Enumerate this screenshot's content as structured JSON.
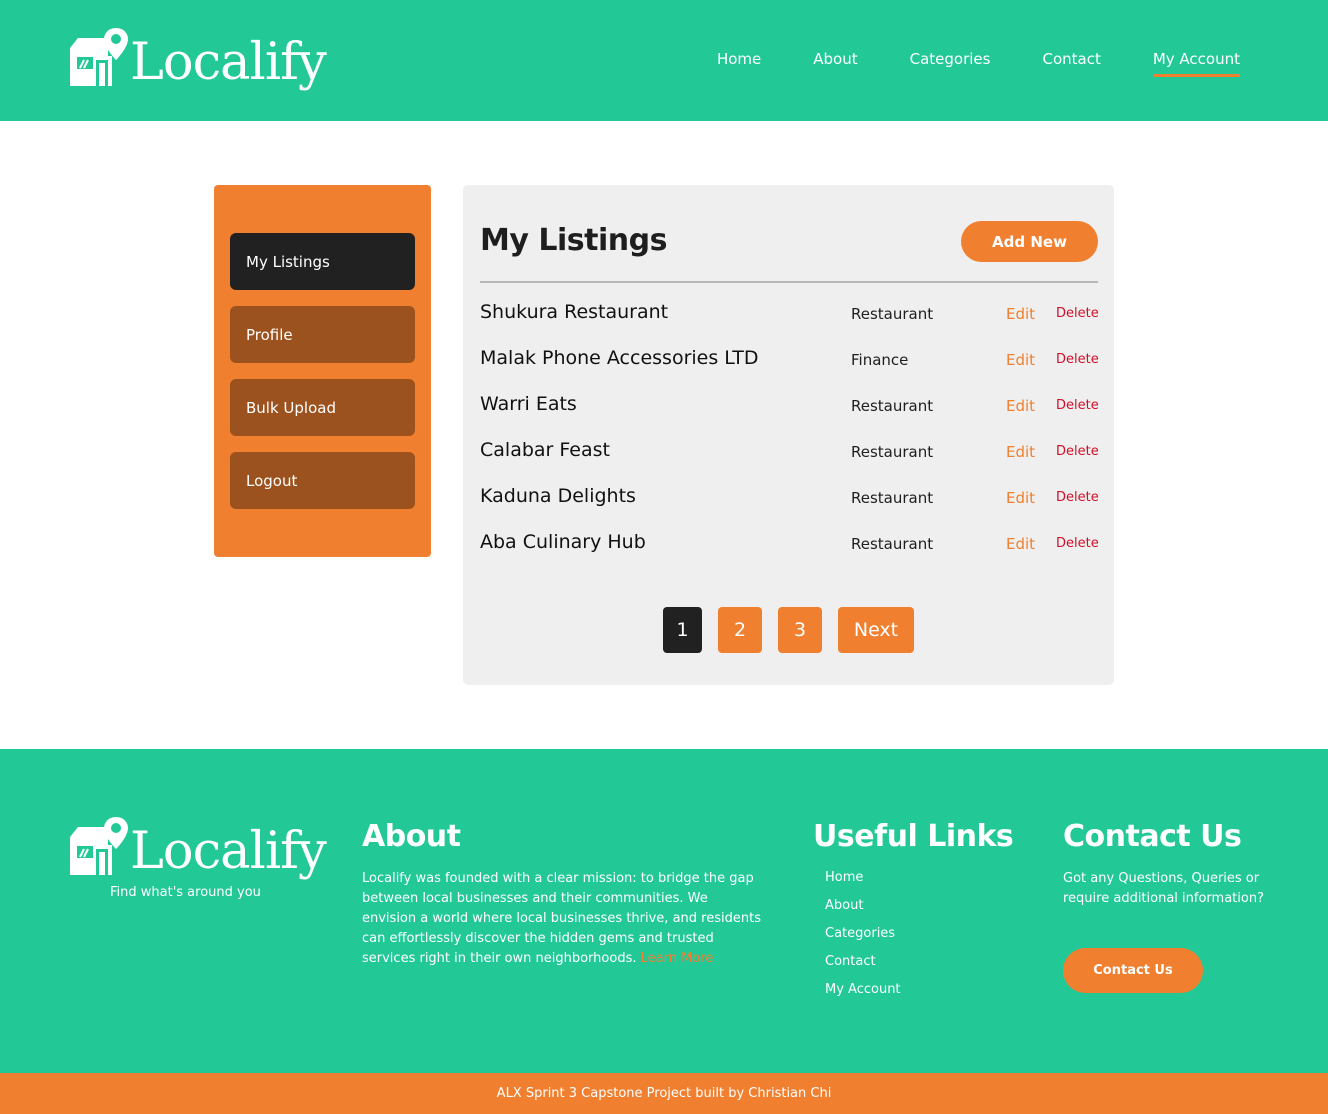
{
  "brand": {
    "name": "Localify",
    "tagline": "Find what's around you"
  },
  "colors": {
    "primary": "#22c997",
    "accent": "#f08030",
    "dark": "#212121",
    "sidebar_button": "#9c521e",
    "delete": "#d0102a"
  },
  "nav": {
    "items": [
      {
        "label": "Home"
      },
      {
        "label": "About"
      },
      {
        "label": "Categories"
      },
      {
        "label": "Contact"
      },
      {
        "label": "My Account",
        "active": true
      }
    ]
  },
  "sidebar": {
    "items": [
      {
        "label": "My Listings",
        "active": true
      },
      {
        "label": "Profile"
      },
      {
        "label": "Bulk Upload"
      },
      {
        "label": "Logout"
      }
    ]
  },
  "listings": {
    "title": "My Listings",
    "add_new_label": "Add New",
    "edit_label": "Edit",
    "delete_label": "Delete",
    "rows": [
      {
        "name": "Shukura Restaurant",
        "category": "Restaurant"
      },
      {
        "name": "Malak Phone Accessories LTD",
        "category": "Finance"
      },
      {
        "name": "Warri Eats",
        "category": "Restaurant"
      },
      {
        "name": "Calabar Feast",
        "category": "Restaurant"
      },
      {
        "name": "Kaduna Delights",
        "category": "Restaurant"
      },
      {
        "name": "Aba Culinary Hub",
        "category": "Restaurant"
      }
    ],
    "pagination": {
      "pages": [
        "1",
        "2",
        "3"
      ],
      "current": "1",
      "next_label": "Next"
    }
  },
  "footer": {
    "about": {
      "heading": "About",
      "text": "Localify was founded with a clear mission: to bridge the gap between local businesses and their communities. We envision a world where local businesses thrive, and residents can effortlessly discover the hidden gems and trusted services right in their own neighborhoods.",
      "learn_more": "Learn More"
    },
    "useful_links": {
      "heading": "Useful Links",
      "items": [
        "Home",
        "About",
        "Categories",
        "Contact",
        "My Account"
      ]
    },
    "contact": {
      "heading": "Contact Us",
      "text": "Got any Questions, Queries or require additional information?",
      "button_label": "Contact Us"
    },
    "credit": "ALX Sprint 3 Capstone Project built by Christian Chi"
  }
}
